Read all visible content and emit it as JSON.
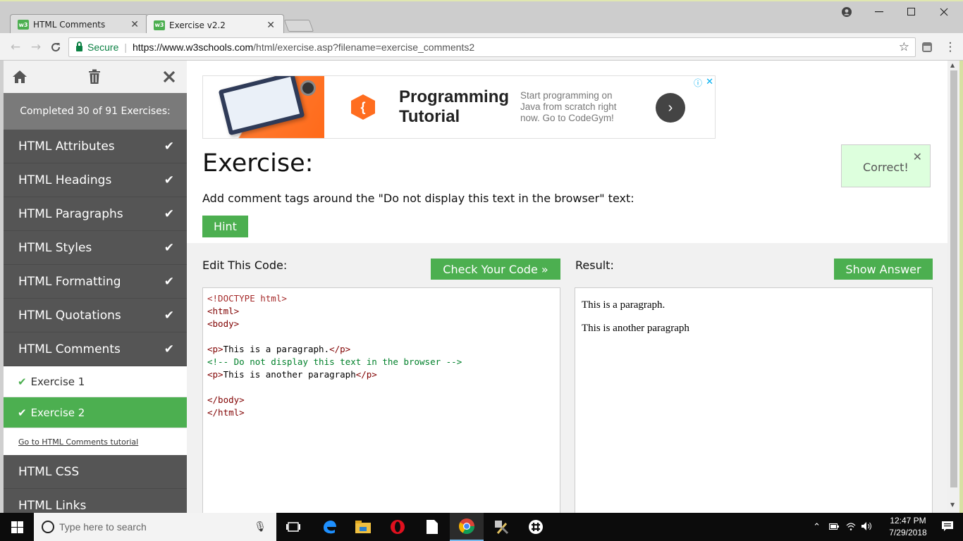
{
  "browser": {
    "tabs": [
      {
        "title": "HTML Comments",
        "favicon": "w3"
      },
      {
        "title": "Exercise v2.2",
        "favicon": "w3"
      }
    ],
    "address": {
      "secure_label": "Secure",
      "url_host": "https://www.w3schools.com",
      "url_path": "/html/exercise.asp?filename=exercise_comments2"
    }
  },
  "sidebar": {
    "progress": "Completed 30 of 91 Exercises:",
    "items": [
      {
        "label": "HTML Attributes"
      },
      {
        "label": "HTML Headings"
      },
      {
        "label": "HTML Paragraphs"
      },
      {
        "label": "HTML Styles"
      },
      {
        "label": "HTML Formatting"
      },
      {
        "label": "HTML Quotations"
      },
      {
        "label": "HTML Comments"
      }
    ],
    "subitems": [
      {
        "label": "Exercise 1"
      },
      {
        "label": "Exercise 2"
      }
    ],
    "tutorial_link": "Go to HTML Comments tutorial",
    "more_items": [
      {
        "label": "HTML CSS"
      },
      {
        "label": "HTML Links"
      }
    ]
  },
  "ad": {
    "logo_glyph": "{",
    "title": "Programming Tutorial",
    "text": "Start programming on Java from scratch right now. Go to CodeGym!"
  },
  "exercise": {
    "title": "Exercise:",
    "task": "Add comment tags around the \"Do not display this text in the browser\" text:",
    "hint_label": "Hint",
    "correct_msg": "Correct!",
    "edit_label": "Edit This Code:",
    "check_label": "Check Your Code »",
    "result_label": "Result:",
    "answer_label": "Show Answer",
    "code": {
      "doctype": "<!DOCTYPE html>",
      "html_open": "<html>",
      "body_open": "<body>",
      "p1_open": "<p>",
      "p1_text": "This is a paragraph.",
      "p1_close": "</p>",
      "comment": "<!-- Do not display this text in the browser -->",
      "p2_open": "<p>",
      "p2_text": "This is another paragraph",
      "p2_close": "</p>",
      "body_close": "</body>",
      "html_close": "</html>"
    },
    "result": {
      "p1": "This is a paragraph.",
      "p2": "This is another paragraph"
    }
  },
  "taskbar": {
    "search_placeholder": "Type here to search",
    "time": "12:47 PM",
    "date": "7/29/2018"
  },
  "colors": {
    "w3_green": "#4CAF50",
    "sidebar_bg": "#555555",
    "correct_bg": "#ddffdd",
    "secure_green": "#0b8043"
  }
}
